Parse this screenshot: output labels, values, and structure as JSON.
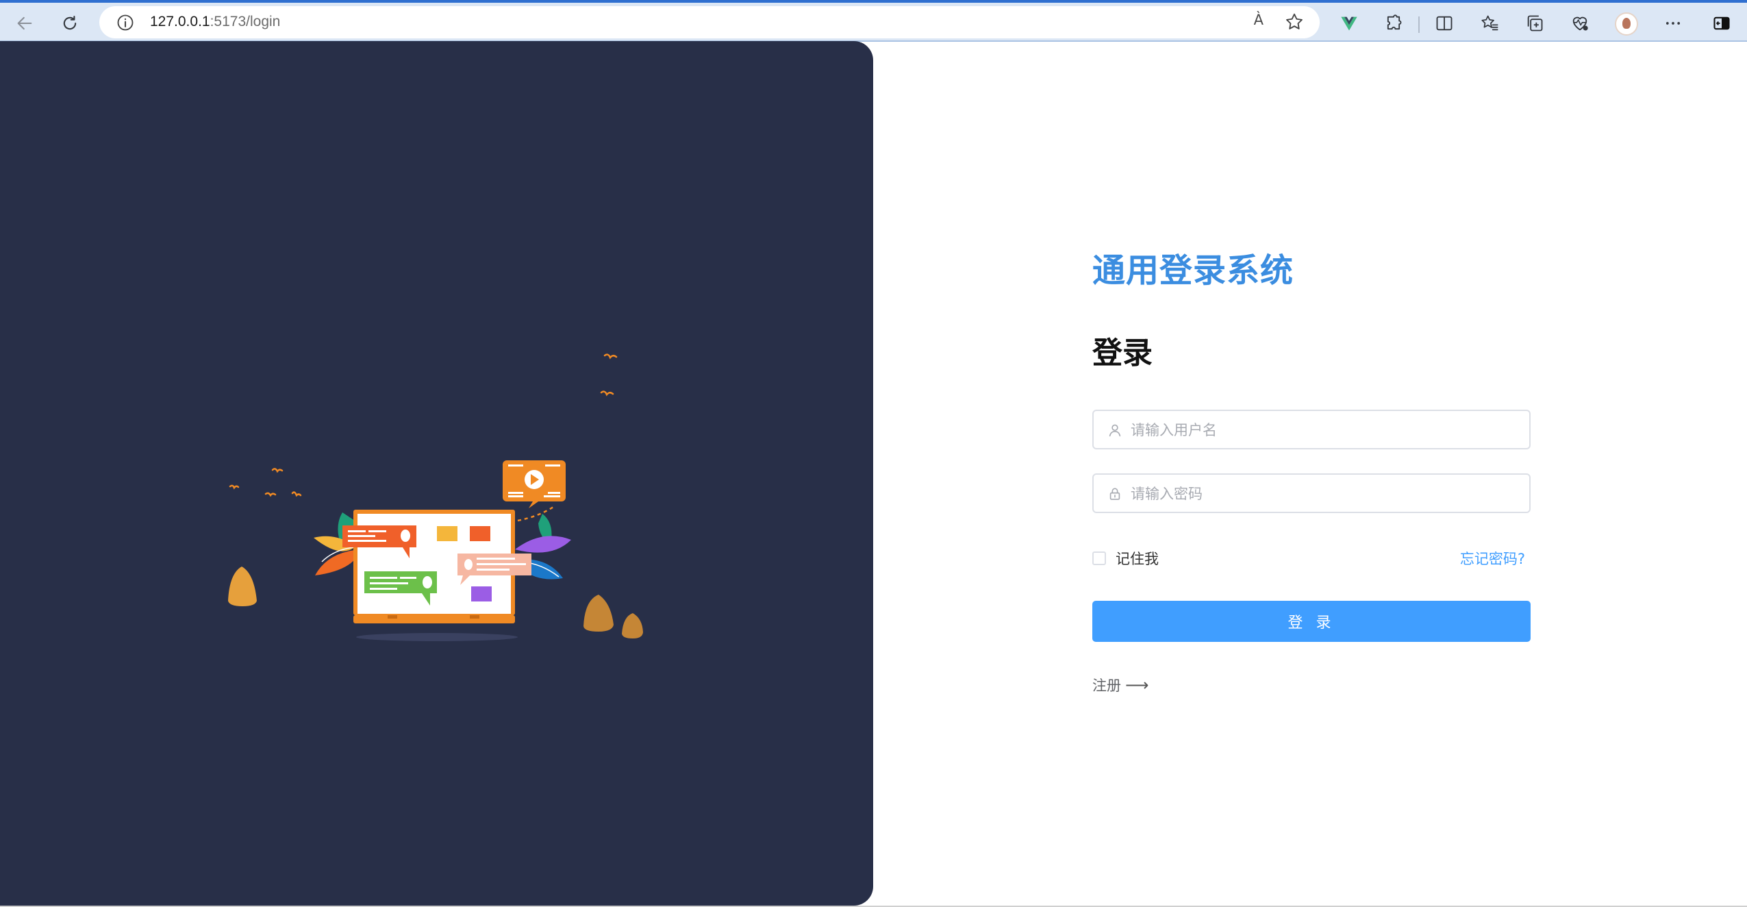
{
  "browser": {
    "url_host": "127.0.0.1",
    "url_path": ":5173/login",
    "read_aloud": "À"
  },
  "login": {
    "system_title": "通用登录系统",
    "heading": "登录",
    "username_placeholder": "请输入用户名",
    "password_placeholder": "请输入密码",
    "remember_label": "记住我",
    "forgot_link": "忘记密码?",
    "submit_label": "登 录",
    "register_label": "注册",
    "register_arrow": "⟶"
  },
  "colors": {
    "panel_bg": "#282f48",
    "title_blue": "#3b8de0",
    "primary_button": "#409eff",
    "illustration_orange": "#f08a24"
  }
}
